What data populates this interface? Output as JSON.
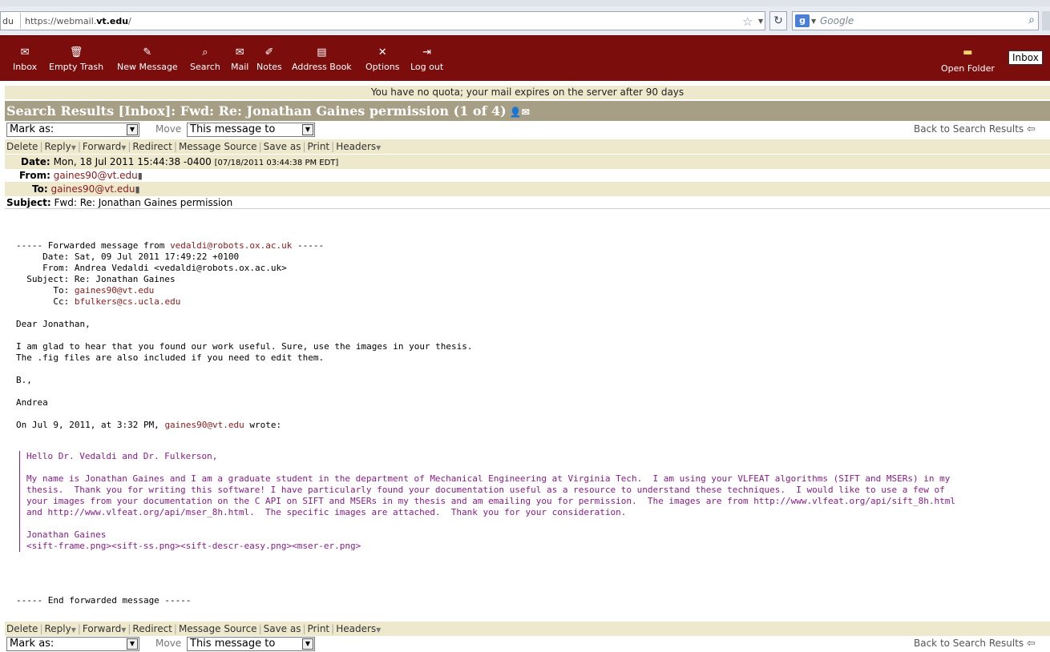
{
  "browser": {
    "url_prefix": "du",
    "url_plain": "https://webmail.",
    "url_bold": "vt.edu",
    "url_suffix": "/",
    "search_placeholder": "Google"
  },
  "toolbar": {
    "items": [
      {
        "label": "Inbox",
        "icon": "envelope-icon"
      },
      {
        "label": "Empty Trash",
        "icon": "trash-icon"
      },
      {
        "label": "New Message",
        "icon": "compose-icon"
      },
      {
        "label": "Search",
        "icon": "search-icon"
      },
      {
        "label": "Mail",
        "icon": "mail-icon"
      },
      {
        "label": "Notes",
        "icon": "notes-icon"
      },
      {
        "label": "Address Book",
        "icon": "address-book-icon"
      },
      {
        "label": "Options",
        "icon": "options-icon"
      },
      {
        "label": "Log out",
        "icon": "logout-icon"
      }
    ],
    "open_folder": "Open Folder",
    "folder_selected": "Inbox"
  },
  "quota_text": "You have no quota; your mail expires on the server after 90 days",
  "title": "Search Results [Inbox]: Fwd: Re: Jonathan Gaines permission (1 of 4)",
  "controls": {
    "mark_as": "Mark as:",
    "move": "Move",
    "target": "This message to",
    "back": "Back to Search Results"
  },
  "actions": {
    "delete": "Delete",
    "reply": "Reply",
    "forward": "Forward",
    "redirect": "Redirect",
    "source": "Message Source",
    "save": "Save as",
    "print": "Print",
    "headers": "Headers"
  },
  "headers": {
    "date_label": "Date:",
    "date_value": "Mon, 18 Jul 2011 15:44:38 -0400",
    "date_local": "[07/18/2011 03:44:38 PM EDT]",
    "from_label": "From:",
    "from_value": "gaines90@vt.edu",
    "to_label": "To:",
    "to_value": "gaines90@vt.edu",
    "subject_label": "Subject:",
    "subject_value": "Fwd: Re: Jonathan Gaines permission"
  },
  "body": {
    "fwd_start": "----- Forwarded message from ",
    "fwd_from_addr": "vedaldi@robots.ox.ac.uk",
    "fwd_start_tail": " -----",
    "fwd_date": "     Date: Sat, 09 Jul 2011 17:49:22 +0100",
    "fwd_from": "     From: Andrea Vedaldi <vedaldi@robots.ox.ac.uk>",
    "fwd_subject": "  Subject: Re: Jonathan Gaines",
    "fwd_to_label": "       To: ",
    "fwd_to": "gaines90@vt.edu",
    "fwd_cc_label": "       Cc: ",
    "fwd_cc": "bfulkers@cs.ucla.edu",
    "greeting": "Dear Jonathan,",
    "line1": "I am glad to hear that you found our work useful. Sure, use the images in your thesis.",
    "line2": "The .fig files are also included if you need to edit them.",
    "sign1": "B.,",
    "sign2": "Andrea",
    "wrote_prefix": "On Jul 9, 2011, at 3:32 PM, ",
    "wrote_addr": "gaines90@vt.edu",
    "wrote_suffix": " wrote:",
    "quote": "Hello Dr. Vedaldi and Dr. Fulkerson,\n\nMy name is Jonathan Gaines and I am a graduate student in the department of Mechanical Engineering at Virginia Tech.  I am using your VLFEAT algorithms (SIFT and MSERs) in my\nthesis.  Thank you for writing this software! I have particularly found your documentation useful as a resource to understand these techniques.  I would like to use a few of\nyour images from your documentation on the C API on SIFT and MSERs in my thesis and am emailing you for permission.  The images are from http://www.vlfeat.org/api/sift_8h.html\nand http://www.vlfeat.org/api/mser_8h.html.  The specific images are attached.  Thank you for your consideration.\n\nJonathan Gaines\n<sift-frame.png><sift-ss.png><sift-descr-easy.png><mser-er.png>",
    "fwd_end": "----- End forwarded message -----"
  }
}
